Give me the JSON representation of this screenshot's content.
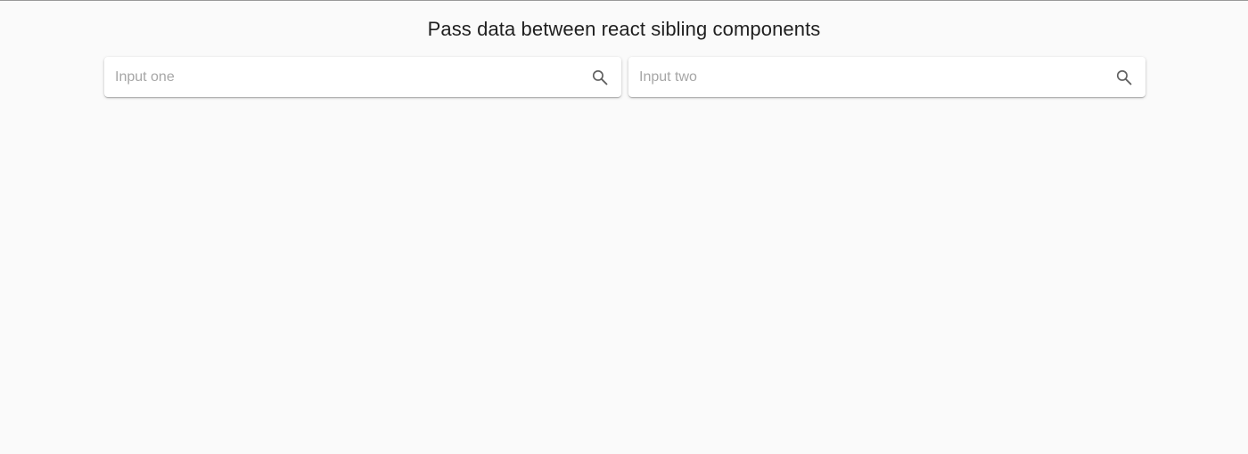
{
  "page": {
    "title": "Pass data between react sibling components"
  },
  "inputs": [
    {
      "placeholder": "Input one",
      "value": "",
      "icon": "search-icon"
    },
    {
      "placeholder": "Input two",
      "value": "",
      "icon": "search-icon"
    }
  ],
  "colors": {
    "background": "#fafafa",
    "card": "#ffffff",
    "title_text": "#1f1f1f",
    "placeholder_text": "#a6a6a6",
    "icon": "#5f5f5f"
  }
}
